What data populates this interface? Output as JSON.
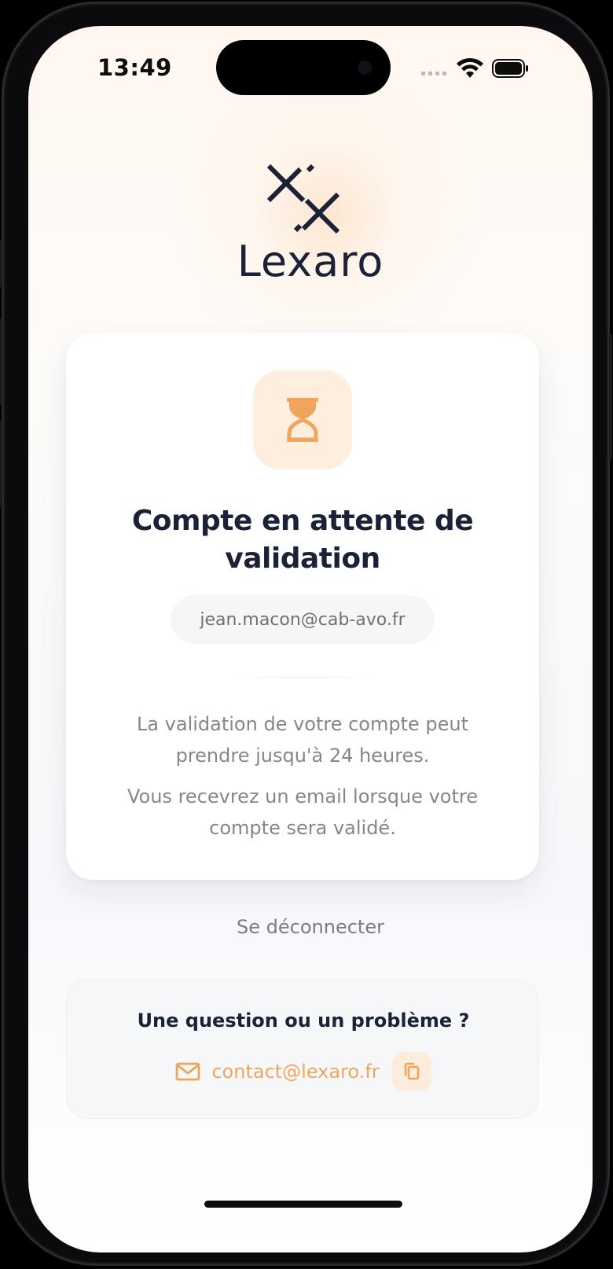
{
  "status_bar": {
    "time": "13:49"
  },
  "logo": {
    "name": "Lexaro",
    "icon": "lexaro-logo-mark"
  },
  "card": {
    "icon": "hourglass-icon",
    "title": "Compte en attente de validation",
    "email": "jean.macon@cab-avo.fr",
    "info_line1": "La validation de votre compte peut prendre jusqu'à 24 heures.",
    "info_line2": "Vous recevrez un email lorsque votre compte sera validé."
  },
  "logout_label": "Se déconnecter",
  "help": {
    "title": "Une question ou un problème ?",
    "contact_email": "contact@lexaro.fr",
    "mail_icon": "mail-icon",
    "copy_icon": "copy-icon"
  },
  "colors": {
    "accent": "#f0a55c",
    "accent_tile": "#fdeedd",
    "navy": "#1b2238"
  }
}
